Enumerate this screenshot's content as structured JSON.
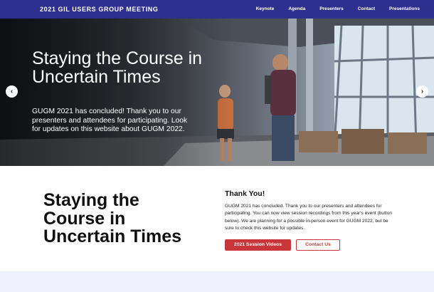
{
  "nav": {
    "brand": "2021 GIL USERS GROUP MEETING",
    "items": [
      "Keynote",
      "Agenda",
      "Presenters",
      "Contact",
      "Presentations"
    ]
  },
  "hero": {
    "title": "Staying the Course in Uncertain Times",
    "text": "GUGM 2021 has concluded! Thank you to our presenters and attendees for participating. Look for updates on this website about GUGM 2022.",
    "prev_label": "‹",
    "next_label": "›"
  },
  "content": {
    "title": "Staying the Course in Uncertain Times",
    "thanks_heading": "Thank You!",
    "thanks_body": "GUGM 2021 has concluded. Thank you to our presenters and attendees for participating. You can now view session recordings from this year's event (button below). We are planning for a possible in-person event for GUGM 2022, but be sure to check this website for updates.",
    "primary_button": "2021 Session Videos",
    "secondary_button": "Contact Us"
  },
  "colors": {
    "nav_bg": "#2e2f8f",
    "accent": "#c8363c",
    "footer_band": "#eef0fb"
  }
}
